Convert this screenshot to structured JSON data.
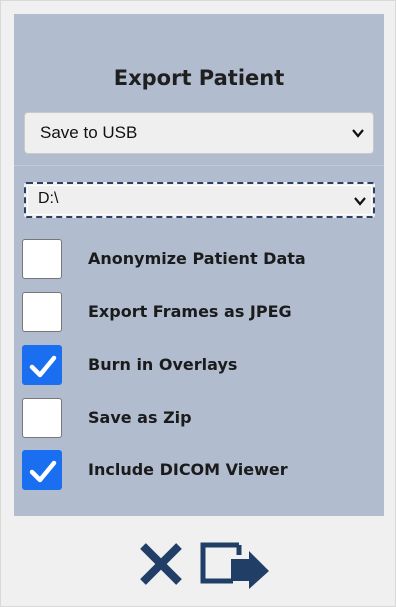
{
  "dialog": {
    "title": "Export Patient"
  },
  "destination": {
    "selected": "Save to USB"
  },
  "path": {
    "selected": "D:\\"
  },
  "options": [
    {
      "label": "Anonymize Patient Data",
      "checked": false
    },
    {
      "label": "Export Frames as JPEG",
      "checked": false
    },
    {
      "label": "Burn in Overlays",
      "checked": true
    },
    {
      "label": "Save as Zip",
      "checked": false
    },
    {
      "label": "Include DICOM Viewer",
      "checked": true
    }
  ],
  "icons": {
    "cancel": "close-icon",
    "export": "export-icon",
    "checkmark": "checkmark-icon",
    "chevron": "chevron-down-icon"
  },
  "colors": {
    "panel_bg": "#b1bccf",
    "accent": "#1a6ef0",
    "icon_navy": "#213f66"
  }
}
